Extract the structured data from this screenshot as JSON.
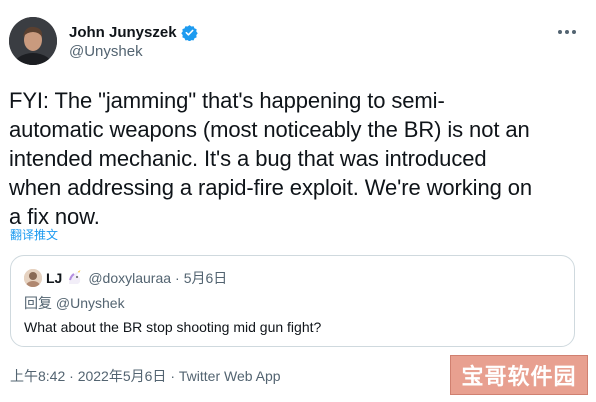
{
  "author": {
    "name": "John Junyszek",
    "handle": "@Unyshek",
    "verified": true,
    "verified_color": "#1d9bf0"
  },
  "more_icon": "more-horizontal-icon",
  "tweet": {
    "text": "FYI: The \"jamming\" that's happening to semi-\nautomatic weapons (most noticeably the BR) is not an\nintended mechanic. It's a bug that was introduced\nwhen addressing a rapid-fire exploit. We're working on\na fix now.",
    "translate_label": "翻译推文"
  },
  "quote": {
    "name": "LJ",
    "emoji_icon": "unicorn-icon",
    "handle": "@doxylauraa",
    "separator": "·",
    "date": "5月6日",
    "reply_prefix": "回复",
    "reply_to": "@Unyshek",
    "text": "What about the BR stop shooting mid gun fight?"
  },
  "meta": {
    "time": "上午8:42",
    "separator": "·",
    "date": "2022年5月6日",
    "app": "Twitter Web App"
  },
  "watermark": {
    "text": "宝哥软件园"
  },
  "colors": {
    "accent": "#1d9bf0",
    "secondary_text": "#536471",
    "border": "#cfd9de",
    "watermark_bg": "#e8a090"
  }
}
